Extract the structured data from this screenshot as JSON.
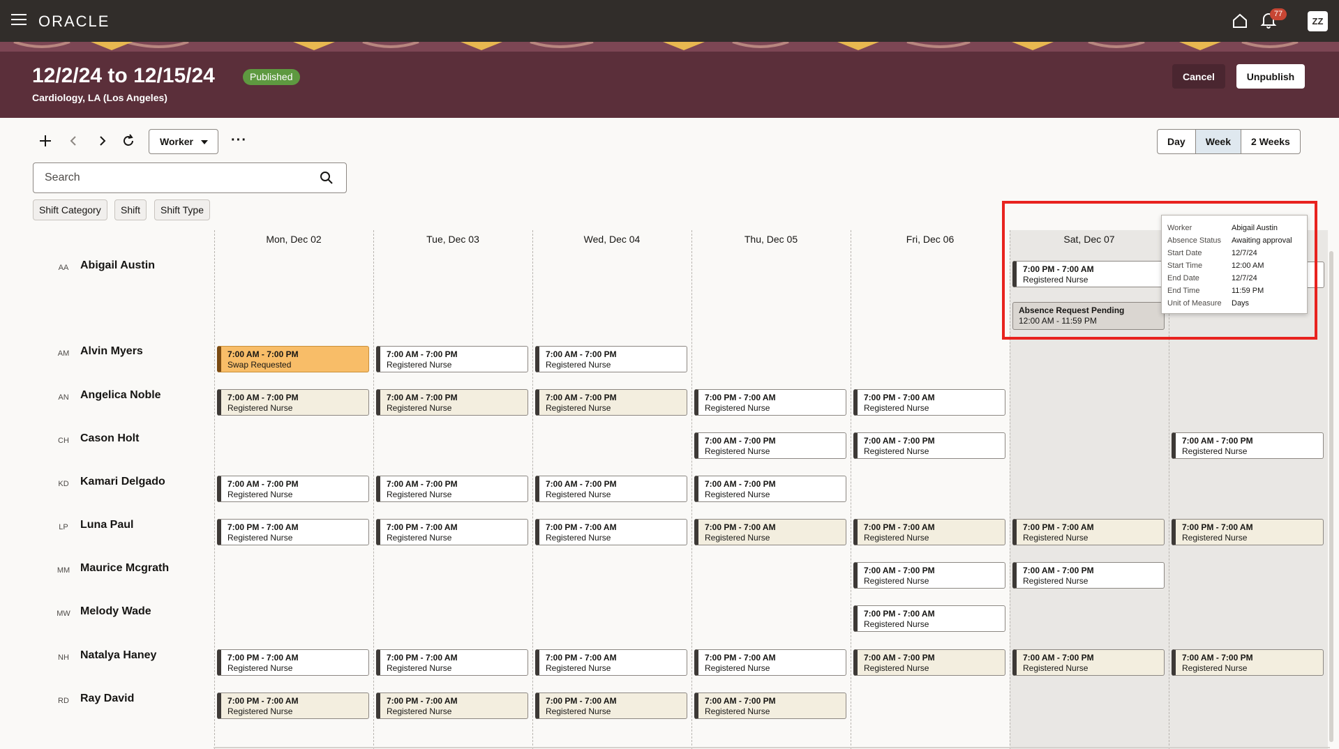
{
  "app": {
    "brand": "ORACLE",
    "notification_count": "77",
    "user_initials": "ZZ"
  },
  "header": {
    "title": "12/2/24 to 12/15/24",
    "status": "Published",
    "subtitle": "Cardiology, LA (Los Angeles)",
    "cancel_label": "Cancel",
    "unpublish_label": "Unpublish"
  },
  "toolbar": {
    "view_by": "Worker",
    "views": [
      "Day",
      "Week",
      "2 Weeks"
    ],
    "active_view": "Week"
  },
  "search": {
    "placeholder": "Search"
  },
  "filters": [
    "Shift Category",
    "Shift",
    "Shift Type"
  ],
  "days": [
    "Mon, Dec 02",
    "Tue, Dec 03",
    "Wed, Dec 04",
    "Thu, Dec 05",
    "Fri, Dec 06",
    "Sat, Dec 07",
    "Sun, Dec 08"
  ],
  "workers": [
    {
      "initials": "AA",
      "name": "Abigail Austin"
    },
    {
      "initials": "AM",
      "name": "Alvin Myers"
    },
    {
      "initials": "AN",
      "name": "Angelica Noble"
    },
    {
      "initials": "CH",
      "name": "Cason Holt"
    },
    {
      "initials": "KD",
      "name": "Kamari Delgado"
    },
    {
      "initials": "LP",
      "name": "Luna Paul"
    },
    {
      "initials": "MM",
      "name": "Maurice Mcgrath"
    },
    {
      "initials": "MW",
      "name": "Melody Wade"
    },
    {
      "initials": "NH",
      "name": "Natalya Haney"
    },
    {
      "initials": "RD",
      "name": "Ray David"
    }
  ],
  "shifts": [
    {
      "w": 0,
      "d": 5,
      "time": "7:00 PM - 7:00 AM",
      "role": "Registered Nurse",
      "style": "white"
    },
    {
      "w": 1,
      "d": 0,
      "time": "7:00 AM - 7:00 PM",
      "role": "Swap Requested",
      "style": "swap"
    },
    {
      "w": 1,
      "d": 1,
      "time": "7:00 AM - 7:00 PM",
      "role": "Registered Nurse",
      "style": "white"
    },
    {
      "w": 1,
      "d": 2,
      "time": "7:00 AM - 7:00 PM",
      "role": "Registered Nurse",
      "style": "white"
    },
    {
      "w": 2,
      "d": 0,
      "time": "7:00 AM - 7:00 PM",
      "role": "Registered Nurse",
      "style": "cream"
    },
    {
      "w": 2,
      "d": 1,
      "time": "7:00 AM - 7:00 PM",
      "role": "Registered Nurse",
      "style": "cream"
    },
    {
      "w": 2,
      "d": 2,
      "time": "7:00 AM - 7:00 PM",
      "role": "Registered Nurse",
      "style": "cream"
    },
    {
      "w": 2,
      "d": 3,
      "time": "7:00 PM - 7:00 AM",
      "role": "Registered Nurse",
      "style": "white"
    },
    {
      "w": 2,
      "d": 4,
      "time": "7:00 PM - 7:00 AM",
      "role": "Registered Nurse",
      "style": "white"
    },
    {
      "w": 3,
      "d": 3,
      "time": "7:00 AM - 7:00 PM",
      "role": "Registered Nurse",
      "style": "white"
    },
    {
      "w": 3,
      "d": 4,
      "time": "7:00 AM - 7:00 PM",
      "role": "Registered Nurse",
      "style": "white"
    },
    {
      "w": 3,
      "d": 6,
      "time": "7:00 AM - 7:00 PM",
      "role": "Registered Nurse",
      "style": "white"
    },
    {
      "w": 4,
      "d": 0,
      "time": "7:00 AM - 7:00 PM",
      "role": "Registered Nurse",
      "style": "white"
    },
    {
      "w": 4,
      "d": 1,
      "time": "7:00 AM - 7:00 PM",
      "role": "Registered Nurse",
      "style": "white"
    },
    {
      "w": 4,
      "d": 2,
      "time": "7:00 AM - 7:00 PM",
      "role": "Registered Nurse",
      "style": "white"
    },
    {
      "w": 4,
      "d": 3,
      "time": "7:00 AM - 7:00 PM",
      "role": "Registered Nurse",
      "style": "white"
    },
    {
      "w": 5,
      "d": 0,
      "time": "7:00 PM - 7:00 AM",
      "role": "Registered Nurse",
      "style": "white"
    },
    {
      "w": 5,
      "d": 1,
      "time": "7:00 PM - 7:00 AM",
      "role": "Registered Nurse",
      "style": "white"
    },
    {
      "w": 5,
      "d": 2,
      "time": "7:00 PM - 7:00 AM",
      "role": "Registered Nurse",
      "style": "white"
    },
    {
      "w": 5,
      "d": 3,
      "time": "7:00 PM - 7:00 AM",
      "role": "Registered Nurse",
      "style": "cream"
    },
    {
      "w": 5,
      "d": 4,
      "time": "7:00 PM - 7:00 AM",
      "role": "Registered Nurse",
      "style": "cream"
    },
    {
      "w": 5,
      "d": 5,
      "time": "7:00 PM - 7:00 AM",
      "role": "Registered Nurse",
      "style": "cream"
    },
    {
      "w": 5,
      "d": 6,
      "time": "7:00 PM - 7:00 AM",
      "role": "Registered Nurse",
      "style": "cream"
    },
    {
      "w": 6,
      "d": 4,
      "time": "7:00 AM - 7:00 PM",
      "role": "Registered Nurse",
      "style": "white"
    },
    {
      "w": 6,
      "d": 5,
      "time": "7:00 AM - 7:00 PM",
      "role": "Registered Nurse",
      "style": "white"
    },
    {
      "w": 7,
      "d": 4,
      "time": "7:00 PM - 7:00 AM",
      "role": "Registered Nurse",
      "style": "white"
    },
    {
      "w": 8,
      "d": 0,
      "time": "7:00 PM - 7:00 AM",
      "role": "Registered Nurse",
      "style": "white"
    },
    {
      "w": 8,
      "d": 1,
      "time": "7:00 PM - 7:00 AM",
      "role": "Registered Nurse",
      "style": "white"
    },
    {
      "w": 8,
      "d": 2,
      "time": "7:00 PM - 7:00 AM",
      "role": "Registered Nurse",
      "style": "white"
    },
    {
      "w": 8,
      "d": 3,
      "time": "7:00 PM - 7:00 AM",
      "role": "Registered Nurse",
      "style": "white"
    },
    {
      "w": 8,
      "d": 4,
      "time": "7:00 AM - 7:00 PM",
      "role": "Registered Nurse",
      "style": "cream"
    },
    {
      "w": 8,
      "d": 5,
      "time": "7:00 AM - 7:00 PM",
      "role": "Registered Nurse",
      "style": "cream"
    },
    {
      "w": 8,
      "d": 6,
      "time": "7:00 AM - 7:00 PM",
      "role": "Registered Nurse",
      "style": "cream"
    },
    {
      "w": 9,
      "d": 0,
      "time": "7:00 PM - 7:00 AM",
      "role": "Registered Nurse",
      "style": "cream"
    },
    {
      "w": 9,
      "d": 1,
      "time": "7:00 PM - 7:00 AM",
      "role": "Registered Nurse",
      "style": "cream"
    },
    {
      "w": 9,
      "d": 2,
      "time": "7:00 PM - 7:00 AM",
      "role": "Registered Nurse",
      "style": "cream"
    },
    {
      "w": 9,
      "d": 3,
      "time": "7:00 AM - 7:00 PM",
      "role": "Registered Nurse",
      "style": "cream"
    }
  ],
  "absence": {
    "title": "Absence Request Pending",
    "time": "12:00 AM - 11:59 PM"
  },
  "absence_popup": [
    {
      "label": "Worker",
      "value": "Abigail Austin"
    },
    {
      "label": "Absence Status",
      "value": "Awaiting approval"
    },
    {
      "label": "Start Date",
      "value": "12/7/24"
    },
    {
      "label": "Start Time",
      "value": "12:00 AM"
    },
    {
      "label": "End Date",
      "value": "12/7/24"
    },
    {
      "label": "End Time",
      "value": "11:59 PM"
    },
    {
      "label": "Unit of Measure",
      "value": "Days"
    }
  ],
  "colors": {
    "topbar": "#312d2a",
    "header": "#5b2f3a",
    "published": "#5e9940",
    "swap": "#f8bd68",
    "highlight": "#e8231f",
    "badge": "#c74634"
  }
}
